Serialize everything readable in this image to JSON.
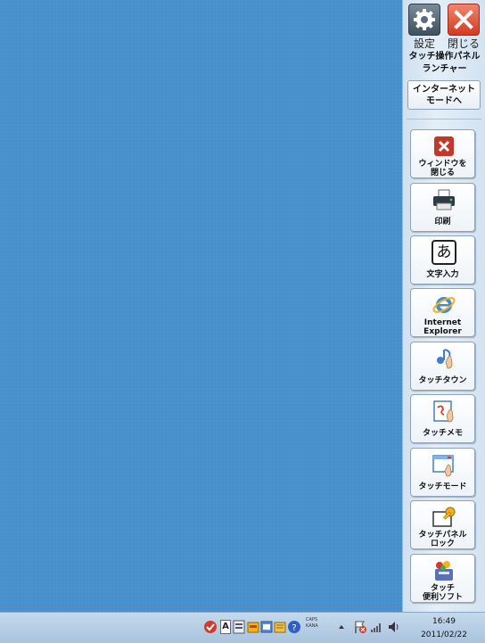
{
  "panel": {
    "settings_label": "設定",
    "close_label": "閉じる",
    "title_line1": "タッチ操作パネル",
    "title_line2": "ランチャー",
    "internet_mode_line1": "インターネット",
    "internet_mode_line2": "モードへ"
  },
  "tiles": [
    {
      "line1": "ウィンドウを",
      "line2": "閉じる",
      "icon": "close-window-icon"
    },
    {
      "line1": "印刷",
      "icon": "printer-icon"
    },
    {
      "line1": "文字入力",
      "icon": "text-input-icon",
      "glyph": "あ"
    },
    {
      "line1": "Internet",
      "line2": "Explorer",
      "icon": "internet-explorer-icon"
    },
    {
      "line1": "タッチタウン",
      "icon": "touch-town-icon"
    },
    {
      "line1": "タッチメモ",
      "icon": "touch-memo-icon"
    },
    {
      "line1": "タッチモード",
      "icon": "touch-mode-icon"
    },
    {
      "line1": "タッチパネル",
      "line2": "ロック",
      "icon": "touch-panel-lock-icon"
    },
    {
      "line1": "タッチ",
      "line2": "便利ソフト",
      "icon": "touch-utility-icon"
    }
  ],
  "taskbar": {
    "caps": "CAPS",
    "kana": "KANA",
    "time": "16:49",
    "date": "2011/02/22",
    "ime_label": "A"
  },
  "colors": {
    "desktop": "#4a92cd",
    "close_button": "#d53a21",
    "panel": "#e3eef8"
  }
}
